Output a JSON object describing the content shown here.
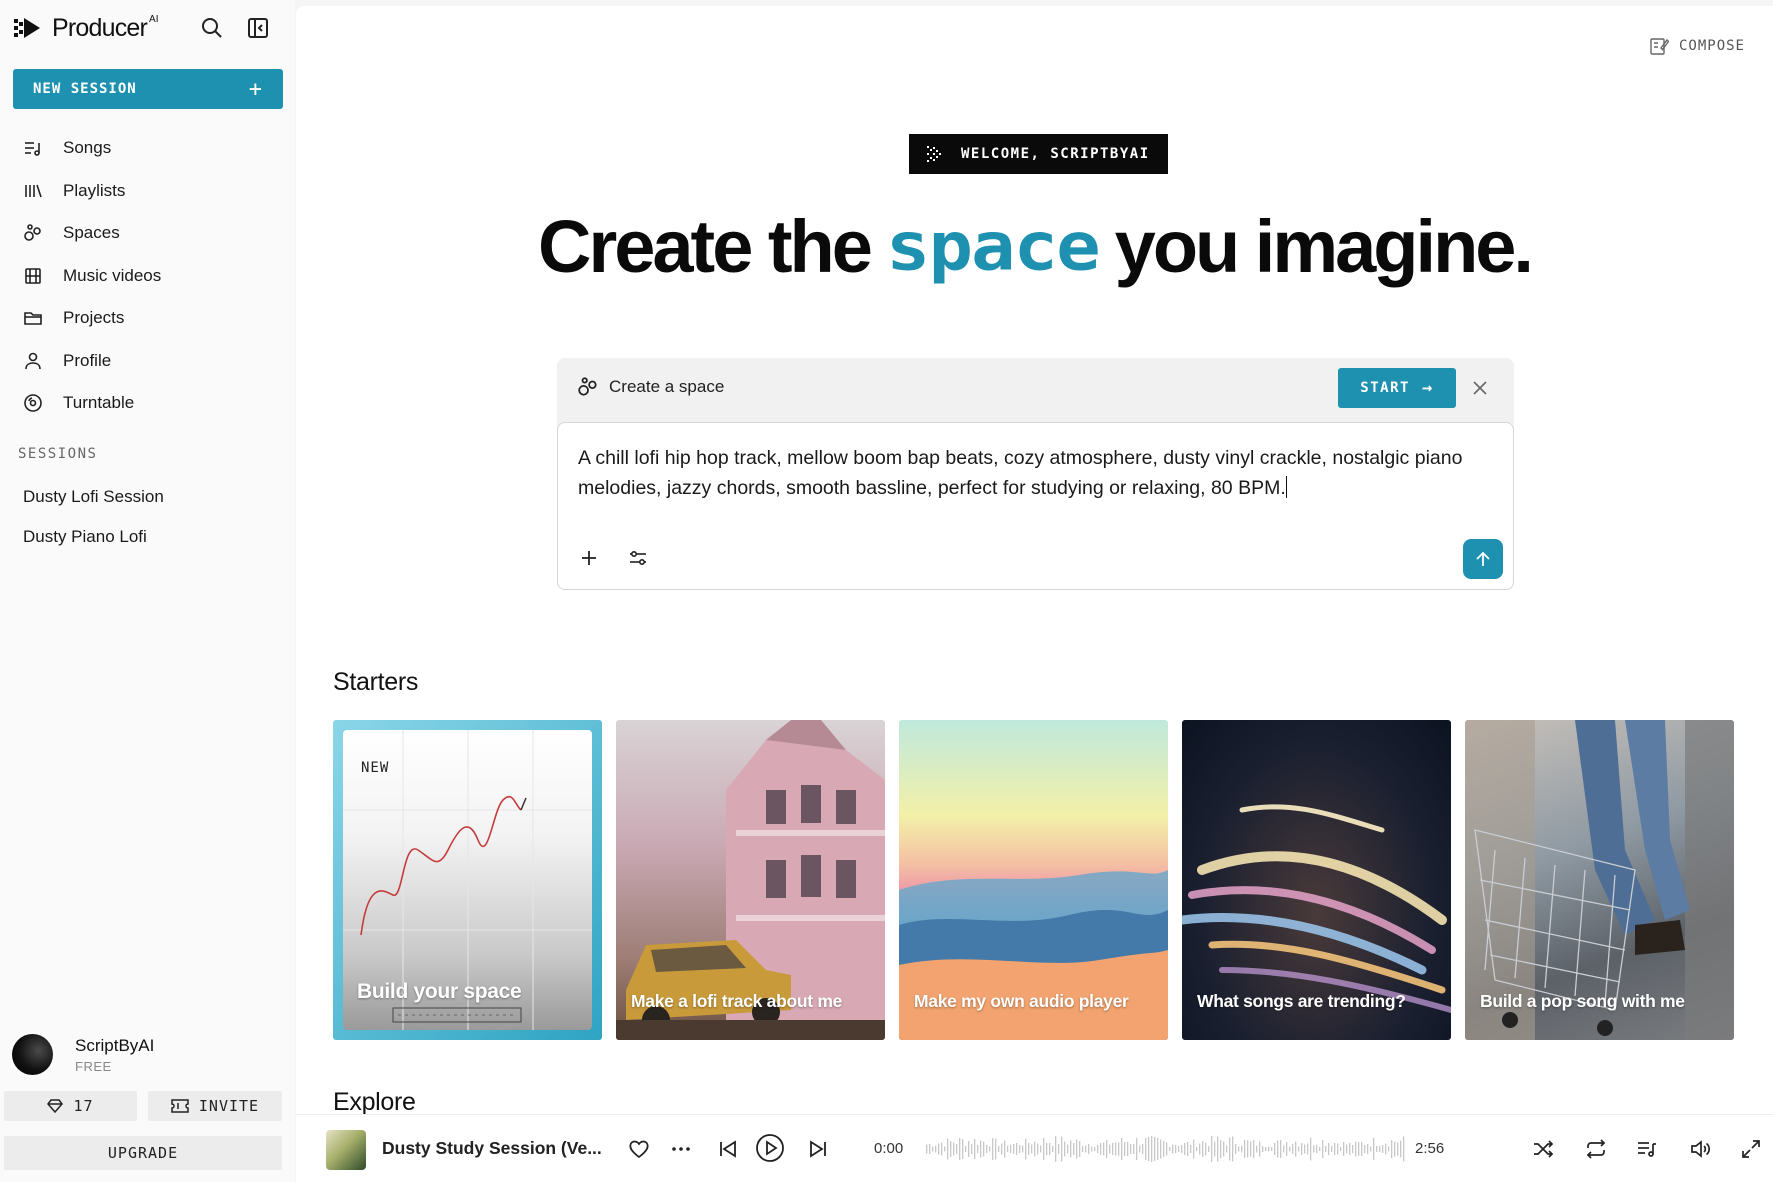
{
  "brand": {
    "name": "Producer",
    "sup": "AI"
  },
  "sidebar": {
    "new_session_label": "NEW SESSION",
    "items": [
      {
        "label": "Songs",
        "icon": "songs-icon"
      },
      {
        "label": "Playlists",
        "icon": "playlists-icon"
      },
      {
        "label": "Spaces",
        "icon": "spaces-icon"
      },
      {
        "label": "Music videos",
        "icon": "film-icon"
      },
      {
        "label": "Projects",
        "icon": "folder-icon"
      },
      {
        "label": "Profile",
        "icon": "user-icon"
      },
      {
        "label": "Turntable",
        "icon": "turntable-icon"
      }
    ],
    "sessions_label": "SESSIONS",
    "sessions": [
      "Dusty Lofi Session",
      "Dusty Piano Lofi"
    ],
    "user": {
      "name": "ScriptByAI",
      "plan": "FREE"
    },
    "credits": "17",
    "invite_label": "INVITE",
    "upgrade_label": "UPGRADE"
  },
  "main": {
    "compose_label": "COMPOSE",
    "welcome_label": "WELCOME, SCRIPTBYAI",
    "headline": {
      "before": "Create the",
      "highlight": "space",
      "after": "you imagine."
    },
    "card": {
      "title": "Create a space",
      "start_label": "START",
      "prompt": "A chill lofi hip hop track, mellow boom bap beats, cozy atmosphere, dusty vinyl crackle, nostalgic piano melodies, jazzy chords, smooth bassline, perfect for studying or relaxing, 80 BPM."
    },
    "starters_title": "Starters",
    "starters": [
      {
        "tag": "NEW",
        "label": "Build your space"
      },
      {
        "label": "Make a lofi track about me"
      },
      {
        "label": "Make my own audio player"
      },
      {
        "label": "What songs are trending?"
      },
      {
        "label": "Build a pop song with me"
      }
    ],
    "explore_title": "Explore"
  },
  "player": {
    "title": "Dusty Study Session (Ve...",
    "current_time": "0:00",
    "duration": "2:56"
  },
  "colors": {
    "accent": "#1e90b0",
    "dark": "#0a0a0a"
  }
}
